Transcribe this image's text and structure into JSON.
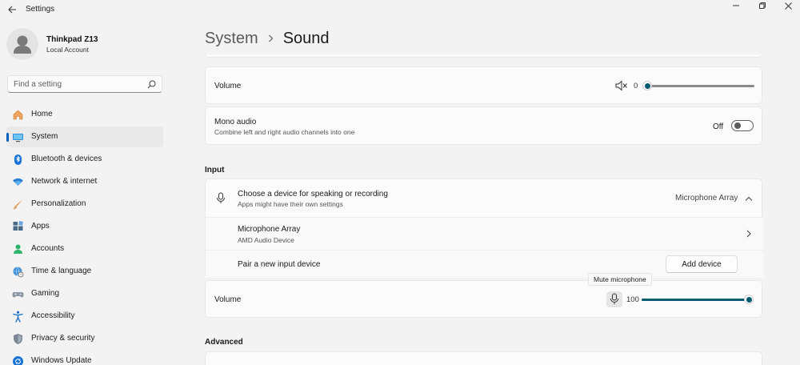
{
  "window": {
    "title": "Settings"
  },
  "profile": {
    "name": "Thinkpad Z13",
    "account": "Local Account"
  },
  "search": {
    "placeholder": "Find a setting"
  },
  "sidebar": {
    "items": [
      {
        "label": "Home",
        "icon": "home-icon"
      },
      {
        "label": "System",
        "icon": "system-icon",
        "active": true
      },
      {
        "label": "Bluetooth & devices",
        "icon": "bluetooth-icon"
      },
      {
        "label": "Network & internet",
        "icon": "wifi-icon"
      },
      {
        "label": "Personalization",
        "icon": "brush-icon"
      },
      {
        "label": "Apps",
        "icon": "apps-icon"
      },
      {
        "label": "Accounts",
        "icon": "person-icon"
      },
      {
        "label": "Time & language",
        "icon": "globe-clock-icon"
      },
      {
        "label": "Gaming",
        "icon": "gamepad-icon"
      },
      {
        "label": "Accessibility",
        "icon": "accessibility-icon"
      },
      {
        "label": "Privacy & security",
        "icon": "shield-icon"
      },
      {
        "label": "Windows Update",
        "icon": "update-icon"
      }
    ]
  },
  "breadcrumb": {
    "parent": "System",
    "current": "Sound"
  },
  "output": {
    "volume": {
      "label": "Volume",
      "value": "0",
      "level": 0
    },
    "mono": {
      "title": "Mono audio",
      "subtitle": "Combine left and right audio channels into one",
      "state": "Off"
    }
  },
  "input": {
    "section_title": "Input",
    "choose": {
      "title": "Choose a device for speaking or recording",
      "subtitle": "Apps might have their own settings",
      "selected": "Microphone Array"
    },
    "device": {
      "title": "Microphone Array",
      "subtitle": "AMD Audio Device"
    },
    "pair": {
      "title": "Pair a new input device",
      "button": "Add device"
    },
    "volume": {
      "label": "Volume",
      "value": "100",
      "level": 1.0,
      "tooltip": "Mute microphone"
    }
  },
  "advanced": {
    "section_title": "Advanced"
  },
  "colors": {
    "accent": "#005fb8",
    "slider": "#005a70"
  }
}
